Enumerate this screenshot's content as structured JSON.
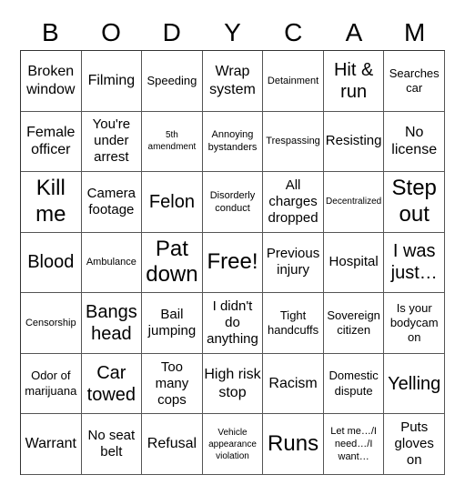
{
  "title_letters": [
    "B",
    "O",
    "D",
    "Y",
    "C",
    "A",
    "M"
  ],
  "cells": [
    [
      "Broken window",
      "Filming",
      "Speeding",
      "Wrap system",
      "Detainment",
      "Hit & run",
      "Searches car"
    ],
    [
      "Female officer",
      "You're under arrest",
      "5th amendment",
      "Annoying bystanders",
      "Trespassing",
      "Resisting",
      "No license"
    ],
    [
      "Kill me",
      "Camera footage",
      "Felon",
      "Disorderly conduct",
      "All charges dropped",
      "Decentralized",
      "Step out"
    ],
    [
      "Blood",
      "Ambulance",
      "Pat down",
      "Free!",
      "Previous injury",
      "Hospital",
      "I was just…"
    ],
    [
      "Censorship",
      "Bangs head",
      "Bail jumping",
      "I didn't do anything",
      "Tight handcuffs",
      "Sovereign citizen",
      "Is your bodycam on"
    ],
    [
      "Odor of marijuana",
      "Car towed",
      "Too many cops",
      "High risk stop",
      "Racism",
      "Domestic dispute",
      "Yelling"
    ],
    [
      "Warrant",
      "No seat belt",
      "Refusal",
      "Vehicle appearance violation",
      "Runs",
      "Let me…/I need…/I want…",
      "Puts gloves on"
    ]
  ],
  "free_space": "Free!",
  "colors": {
    "background": "#ffffff",
    "text": "#000000",
    "grid_line": "#555555"
  }
}
